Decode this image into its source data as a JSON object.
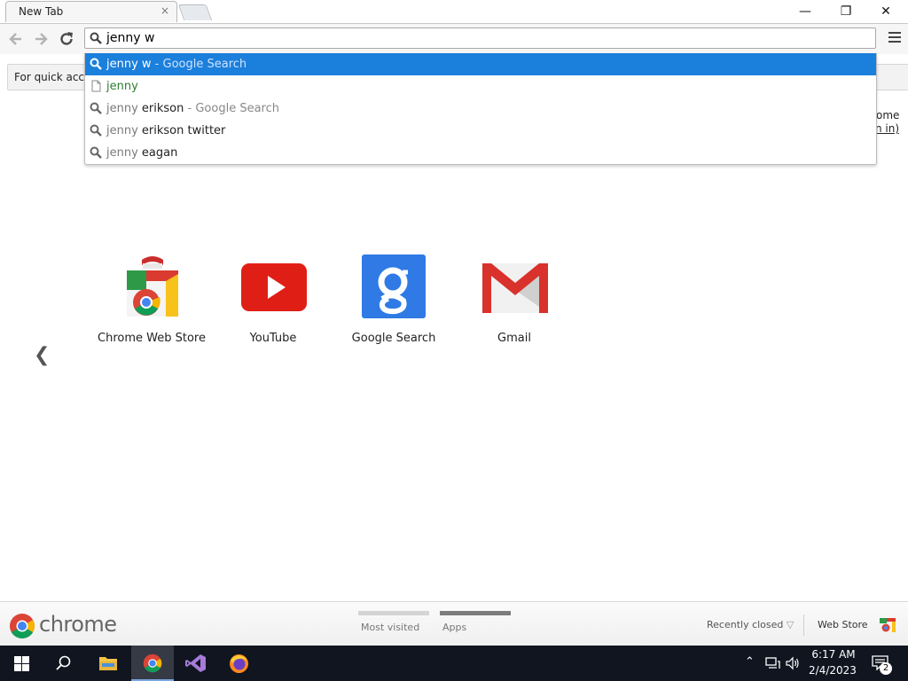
{
  "tab": {
    "title": "New Tab",
    "close_glyph": "×"
  },
  "window_controls": {
    "minimize": "—",
    "restore": "❐",
    "close": "✕"
  },
  "omnibox": {
    "value": "jenny w"
  },
  "infobar": {
    "text": "For quick acces"
  },
  "signin": {
    "line1": "ome",
    "line2": "n in)"
  },
  "suggestions": [
    {
      "icon": "search-icon",
      "typed": "jenny w",
      "rest": "",
      "suffix": " - Google Search",
      "selected": true
    },
    {
      "icon": "page-icon",
      "url": "jenny"
    },
    {
      "icon": "search-icon",
      "typed": "jenny",
      "rest": " erikson",
      "suffix": " - Google Search"
    },
    {
      "icon": "search-icon",
      "typed": "jenny",
      "rest": " erikson twitter",
      "suffix": ""
    },
    {
      "icon": "search-icon",
      "typed": "jenny",
      "rest": " eagan",
      "suffix": ""
    }
  ],
  "tiles": [
    {
      "label": "Chrome Web Store",
      "icon": "chrome-web-store-icon"
    },
    {
      "label": "YouTube",
      "icon": "youtube-icon"
    },
    {
      "label": "Google Search",
      "icon": "google-search-icon"
    },
    {
      "label": "Gmail",
      "icon": "gmail-icon"
    }
  ],
  "prev_arrow": "❮",
  "footer": {
    "brand": "chrome",
    "pager": [
      "Most visited",
      "Apps"
    ],
    "active_page": "Apps",
    "recently_closed": "Recently closed",
    "web_store": "Web Store"
  },
  "taskbar": {
    "time": "6:17 AM",
    "date": "2/4/2023",
    "notifications": "2",
    "accent": "#7aa7e0"
  },
  "colors": {
    "selected_suggestion": "#1b7fdc",
    "url_green": "#2e7d32",
    "taskbar_bg": "#101520"
  }
}
